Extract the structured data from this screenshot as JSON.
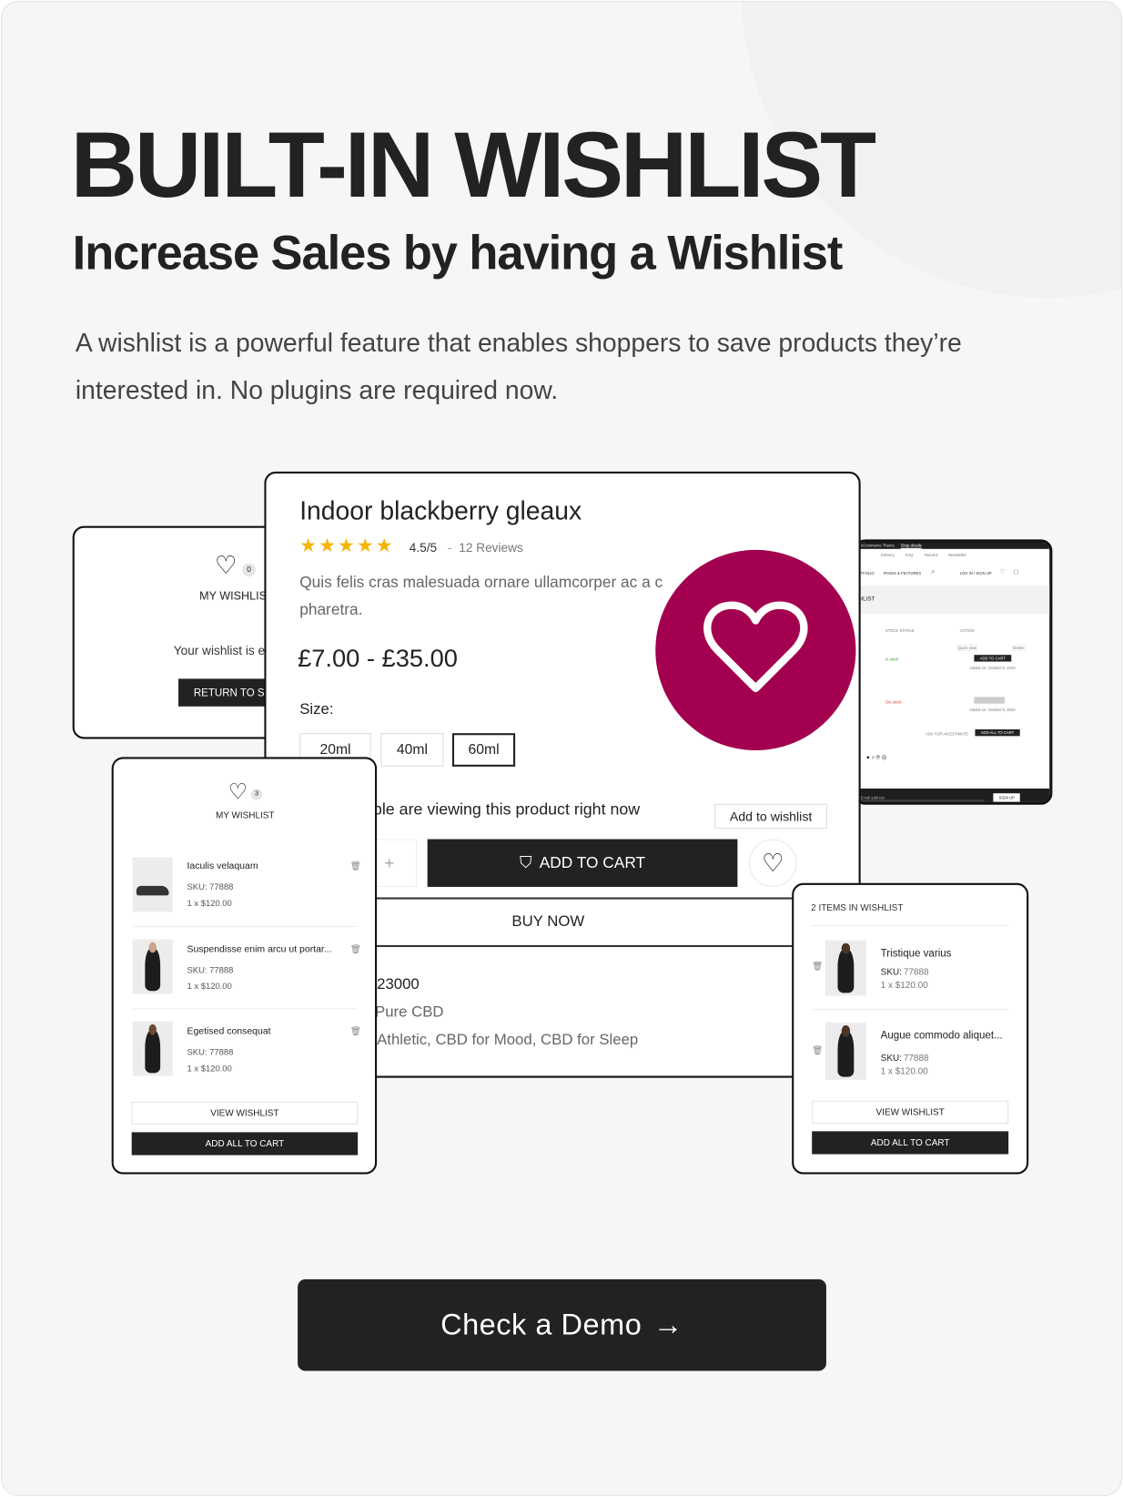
{
  "hero": {
    "title": "BUILT-IN WISHLIST",
    "subtitle": "Increase Sales by having a Wishlist",
    "description": "A wishlist is a powerful feature that enables shoppers to save products they’re interested in. No plugins are required now."
  },
  "colors": {
    "accent": "#a3004f",
    "dark": "#222222",
    "background": "#f6f6f6"
  },
  "empty_wishlist": {
    "count": "0",
    "heading": "MY WISHLIS",
    "message": "Your wishlist is e",
    "button": "RETURN TO SH"
  },
  "product": {
    "title": "Indoor blackberry gleaux",
    "rating": "4.5/5",
    "separator": "-",
    "reviews": "12 Reviews",
    "stars": 4.5,
    "description": "Quis felis cras malesuada ornare ullamcorper ac a c pharetra.",
    "price": "£7.00 - £35.00",
    "size_label": "Size:",
    "sizes": [
      "20ml",
      "40ml",
      "60ml"
    ],
    "selected_size": "60ml",
    "viewing": "ple are viewing this product right now",
    "tooltip": "Add to wishlist",
    "qty_plus": "+",
    "add_to_cart": "ADD TO CART",
    "buy_now": "BUY NOW",
    "meta": [
      "23000",
      "Pure CBD",
      "Athletic, CBD for Mood, CBD for Sleep"
    ]
  },
  "wishlist_left": {
    "count": "3",
    "heading": "MY WISHLIST",
    "items": [
      {
        "name": "Iaculis velaquam",
        "sku": "SKU: 77888",
        "price": "1 x $120.00"
      },
      {
        "name": "Suspendisse enim arcu ut portar...",
        "sku": "SKU: 77888",
        "price": "1 x $120.00"
      },
      {
        "name": "Egetised consequat",
        "sku": "SKU: 77888",
        "price": "1 x $120.00"
      }
    ],
    "view": "VIEW WISHLIST",
    "add_all": "ADD ALL TO CART"
  },
  "wishlist_right": {
    "heading": "2 ITEMS IN WISHLIST",
    "items": [
      {
        "name": "Tristique varius",
        "sku_label": "SKU:",
        "sku": "77888",
        "price": "1 x $120.00"
      },
      {
        "name": "Augue commodo aliquet...",
        "sku_label": "SKU:",
        "sku": "77888",
        "price": "1 x $120.00"
      }
    ],
    "view": "VIEW WISHLIST",
    "add_all": "ADD ALL TO CART"
  },
  "desktop_preview": {
    "topbar": "ooCommerce Theme",
    "topbar_link": "Shop details",
    "links": [
      "Delivery",
      "FAQ",
      "Returns",
      "Newsletter"
    ],
    "nav": [
      "RTFOLIO",
      "PAGES & FEATURES"
    ],
    "account": "LOG IN / SIGN UP",
    "page_title": "HLIST",
    "col_stock": "STOCK STATUS",
    "col_action": "ACTION",
    "quick_view": "Quick view",
    "delete": "Delete",
    "in_stock": "In stock",
    "out_stock": "Out stock",
    "add_to_cart": "ADD TO CART",
    "added_on": "Added on: October 5, 2023",
    "ask": "ASK FOR AN ESTIMATE",
    "add_all": "ADD ALL TO CART",
    "email": "Email address",
    "signup": "SIGN UP"
  },
  "cta": {
    "label": "Check a Demo",
    "arrow": "→"
  }
}
